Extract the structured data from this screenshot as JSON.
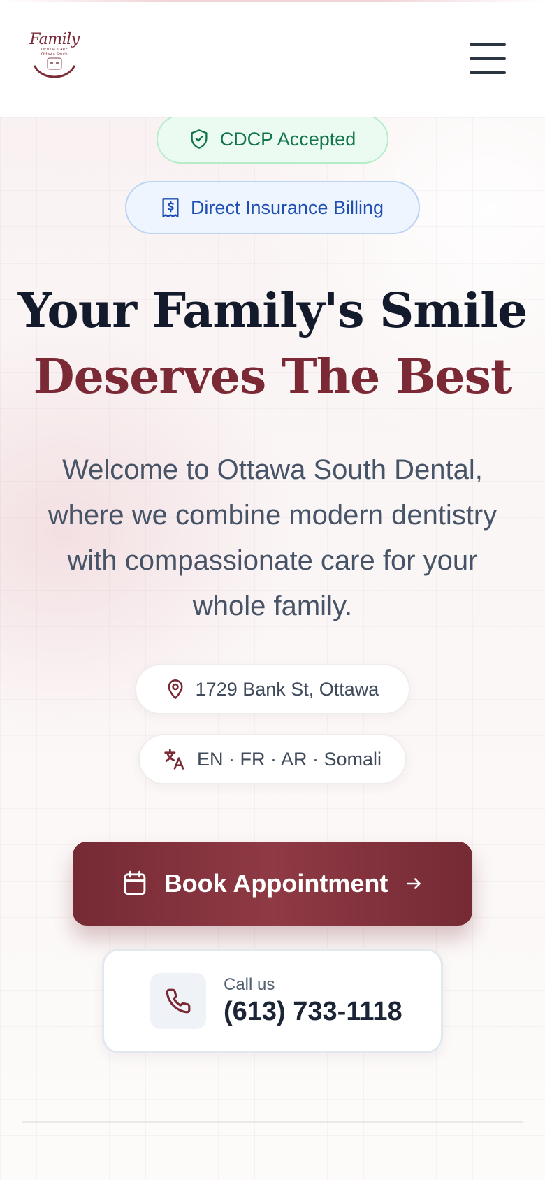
{
  "header": {
    "logo": {
      "script_text": "Family",
      "line1": "DENTAL CARE",
      "line2": "Ottawa South"
    },
    "menu_icon": "hamburger-menu-icon"
  },
  "badges": {
    "cdcp": {
      "label": "CDCP Accepted",
      "icon": "shield-check-icon",
      "color": "#14754a"
    },
    "insurance": {
      "label": "Direct Insurance Billing",
      "icon": "receipt-dollar-icon",
      "color": "#1f4fb3"
    }
  },
  "hero": {
    "headline_line1": "Your Family's Smile",
    "headline_line2": "Deserves The Best",
    "intro": "Welcome to Ottawa South Dental, where we combine modern dentistry with compassionate care for your whole family."
  },
  "info_chips": {
    "address": {
      "label": "1729 Bank St, Ottawa",
      "icon": "map-pin-icon"
    },
    "languages": {
      "label": "EN · FR · AR · Somali",
      "icon": "translate-icon"
    }
  },
  "cta": {
    "book_label": "Book Appointment",
    "book_icons": [
      "calendar-icon",
      "arrow-right-icon"
    ],
    "call_label": "Call us",
    "call_number": "(613) 733-1118",
    "call_icon": "phone-icon"
  },
  "colors": {
    "brand": "#7b2a35",
    "heading": "#131a2c",
    "body_text": "#475467"
  }
}
